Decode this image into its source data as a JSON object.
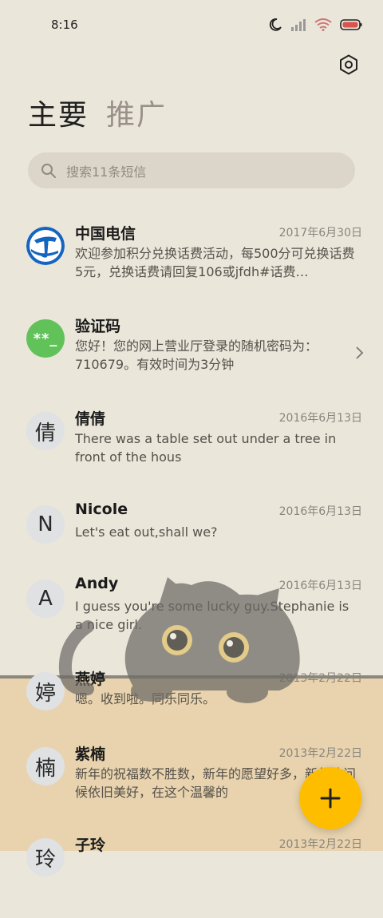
{
  "status_bar": {
    "time": "8:16"
  },
  "tabs": {
    "primary": "主要",
    "promotions": "推广"
  },
  "search": {
    "placeholder": "搜索11条短信"
  },
  "messages": [
    {
      "sender": "中国电信",
      "date": "2017年6月30日",
      "preview": "欢迎参加积分兑换话费活动，每500分可兑换话费5元，兑换话费请回复106或jfdh#话费…",
      "avatar": "telecom-logo"
    },
    {
      "sender": "验证码",
      "date": "",
      "preview": "您好！您的网上营业厅登录的随机密码为：710679。有效时间为3分钟",
      "avatar_text": "**_"
    },
    {
      "sender": "倩倩",
      "date": "2016年6月13日",
      "preview": "There was a table set out under a tree in front of the hous",
      "avatar_text": "倩"
    },
    {
      "sender": "Nicole",
      "date": "2016年6月13日",
      "preview": "Let's eat out,shall we?",
      "avatar_text": "N"
    },
    {
      "sender": "Andy",
      "date": "2016年6月13日",
      "preview": "I guess you're some lucky guy.Stephanie is a nice girl.",
      "avatar_text": "A"
    },
    {
      "sender": "燕婷",
      "date": "2013年2月22日",
      "preview": "嗯。收到啦。同乐同乐。",
      "avatar_text": "婷"
    },
    {
      "sender": "紫楠",
      "date": "2013年2月22日",
      "preview": "新年的祝福数不胜数，新年的愿望好多，新年的问候依旧美好，在这个温馨的",
      "avatar_text": "楠"
    },
    {
      "sender": "子玲",
      "date": "2013年2月22日",
      "preview": "",
      "avatar_text": "玲"
    }
  ],
  "colors": {
    "fab": "#ffbd00",
    "background": "#ebe6da",
    "lower_background": "#e8d3ae"
  },
  "icons": [
    "moon-icon",
    "signal-icon",
    "wifi-icon",
    "battery-icon",
    "settings-icon",
    "search-icon",
    "chevron-right-icon",
    "plus-icon"
  ]
}
